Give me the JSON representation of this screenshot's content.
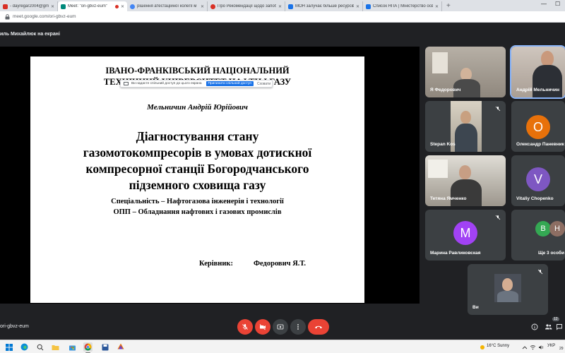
{
  "browser": {
    "tabs": [
      {
        "label": "- dayregar2004@gmai",
        "color": "#d93025"
      },
      {
        "label": "Meet: \"ori-gbvz-eum\"",
        "color": "#00897b",
        "active": true
      },
      {
        "label": "рішення атестаційної колегії м",
        "color": "#4285f4"
      },
      {
        "label": "Про Рекомендації щодо запоб",
        "color": "#d93025"
      },
      {
        "label": "МОН залучає більше ресурсів",
        "color": "#1a73e8"
      },
      {
        "label": "Список НПА | Міністерство осв",
        "color": "#1a73e8"
      }
    ],
    "new_tab": "+",
    "minimize": "—",
    "maximize": "☐",
    "url": "meet.google.com/ori-gbvz-eum"
  },
  "meet": {
    "presenter_label": "иль Михайлюк на екрані",
    "share_banner": {
      "text": "Ви надаєте спільний доступ до цього екрана",
      "stop_label": "Припинити спільний доступ",
      "hide_label": "Сховати"
    },
    "slide": {
      "institution_line1": "ІВАНО-ФРАНКІВСЬКИЙ НАЦІОНАЛЬНИЙ",
      "institution_line2": "ТЕХНІЧНИЙ УНІВЕРСИТЕТ НАФТИ І ГАЗУ",
      "author": "Мельничин Андрій Юрійович",
      "title_lines": [
        "Діагностування стану",
        "газомотокомпресорів в умовах дотискної",
        "компресорної станції Богородчанського",
        "підземного сховища газу"
      ],
      "specialty": "Спеціальність  – Нафтогазова інженерія і технології",
      "program": "ОПП – Обладнання нафтових і газових промислів",
      "supervisor_label": "Керівник:",
      "supervisor_name": "Федорович Я.Т."
    },
    "participants": [
      {
        "name": "Я Федорович",
        "type": "video",
        "muted": false
      },
      {
        "name": "Андрій Мельничин",
        "type": "video",
        "muted": false,
        "active": true
      },
      {
        "name": "Stepan Kos",
        "type": "video",
        "muted": true
      },
      {
        "name": "Олександр Паневник",
        "type": "avatar",
        "initial": "О",
        "color": "#e8710a",
        "muted": true
      },
      {
        "name": "Тетяна Ямченко",
        "type": "video",
        "muted": false
      },
      {
        "name": "Vitaliy Chopenko",
        "type": "avatar",
        "initial": "V",
        "color": "#7e57c2",
        "muted": true
      },
      {
        "name": "Марина Равликовская",
        "type": "avatar",
        "initial": "М",
        "color": "#a142f4",
        "muted": true
      },
      {
        "name": "Ще 3 особи",
        "type": "group",
        "initials": [
          "В",
          "Н"
        ],
        "colors": [
          "#34a853",
          "#8d6e63"
        ]
      },
      {
        "name": "Ви",
        "type": "video",
        "muted": true
      }
    ],
    "meeting_code": "ori-gbvz-eum",
    "participant_count": "12"
  },
  "taskbar": {
    "weather": "16°C  Sunny",
    "language": "УКР",
    "clock": "29"
  }
}
